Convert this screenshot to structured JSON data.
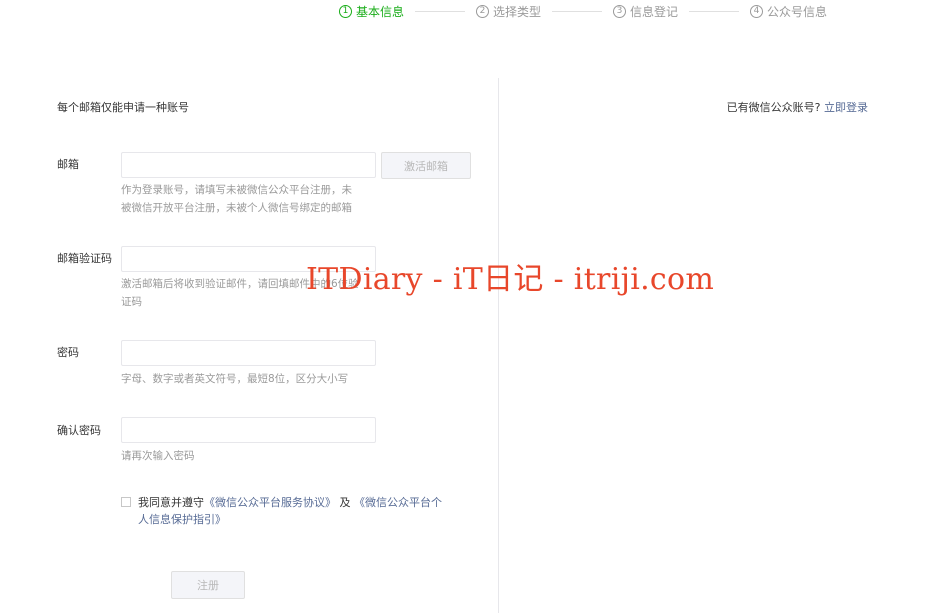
{
  "steps": [
    {
      "num": "1",
      "label": "基本信息"
    },
    {
      "num": "2",
      "label": "选择类型"
    },
    {
      "num": "3",
      "label": "信息登记"
    },
    {
      "num": "4",
      "label": "公众号信息"
    }
  ],
  "form": {
    "top_hint": "每个邮箱仅能申请一种账号",
    "email": {
      "label": "邮箱",
      "value": "",
      "activate_label": "激活邮箱",
      "tip_line1": "作为登录账号，请填写未被微信公众平台注册，未",
      "tip_line2": "被微信开放平台注册，未被个人微信号绑定的邮箱"
    },
    "code": {
      "label": "邮箱验证码",
      "value": "",
      "tip_line1": "激活邮箱后将收到验证邮件，请回填邮件中的6位验",
      "tip_line2": "证码"
    },
    "password": {
      "label": "密码",
      "value": "",
      "tip": "字母、数字或者英文符号，最短8位，区分大小写"
    },
    "confirm": {
      "label": "确认密码",
      "value": "",
      "tip": "请再次输入密码"
    },
    "agreement": {
      "prefix": "我同意并遵守",
      "link1": "《微信公众平台服务协议》",
      "middle": "及",
      "link2": "《微信公众平台个人信息保护指引》"
    },
    "register_label": "注册"
  },
  "right": {
    "login_prompt": "已有微信公众账号?",
    "login_link": "立即登录"
  },
  "watermark": "ITDiary - iT日记 - itriji.com",
  "colors": {
    "accent": "#1aad19",
    "link": "#576b95",
    "muted": "#9a9a9a",
    "watermark": "#e8472b"
  }
}
